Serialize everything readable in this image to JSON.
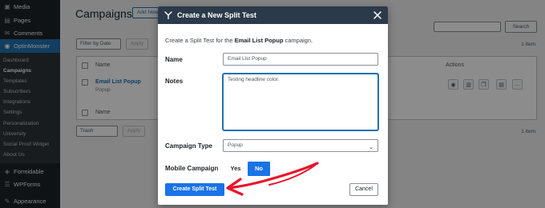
{
  "sidebar": {
    "items": [
      {
        "label": "Media",
        "icon": "media-icon"
      },
      {
        "label": "Pages",
        "icon": "pages-icon"
      },
      {
        "label": "Comments",
        "icon": "comments-icon"
      },
      {
        "label": "OptinMonster",
        "icon": "optinmonster-icon"
      }
    ],
    "submenu": [
      "Dashboard",
      "Campaigns",
      "Templates",
      "Subscribers",
      "Integrations",
      "Settings",
      "Personalization",
      "University",
      "Social Proof Widget",
      "About Us"
    ],
    "bottom_items": [
      {
        "label": "Formidable",
        "icon": "formidable-icon"
      },
      {
        "label": "WPForms",
        "icon": "wpforms-icon"
      },
      {
        "label": "Appearance",
        "icon": "appearance-icon"
      }
    ]
  },
  "page": {
    "title": "Campaigns",
    "add_new": "Add New",
    "search_button": "Search",
    "filter_label": "Filter by Date",
    "apply": "Apply",
    "items_count": "1 item",
    "columns": {
      "name": "Name",
      "actions": "Actions"
    },
    "rows": [
      {
        "name": "Email List Popup",
        "type": "Popup"
      }
    ],
    "row_actions": [
      "eye-icon",
      "chart-icon",
      "copy-icon",
      "archive-icon",
      "more-icon"
    ],
    "more_label": "...",
    "bulk_label": "Trash"
  },
  "modal": {
    "title": "Create a New Split Test",
    "description_prefix": "Create a Split Test for the ",
    "campaign_name": "Email List Popup",
    "description_suffix": " campaign.",
    "name_label": "Name",
    "name_value": "Email List Popup",
    "notes_label": "Notes",
    "notes_value": "Testing headline color.",
    "campaign_type_label": "Campaign Type",
    "campaign_type_value": "Popup",
    "mobile_label": "Mobile Campaign",
    "yes_label": "Yes",
    "no_label": "No",
    "create_button": "Create Split Test",
    "cancel_button": "Cancel"
  },
  "colors": {
    "accent": "#1a73e8",
    "header": "#2b3a4a",
    "sidebar_active": "#2271b1",
    "annotation_arrow": "#e8152a"
  }
}
